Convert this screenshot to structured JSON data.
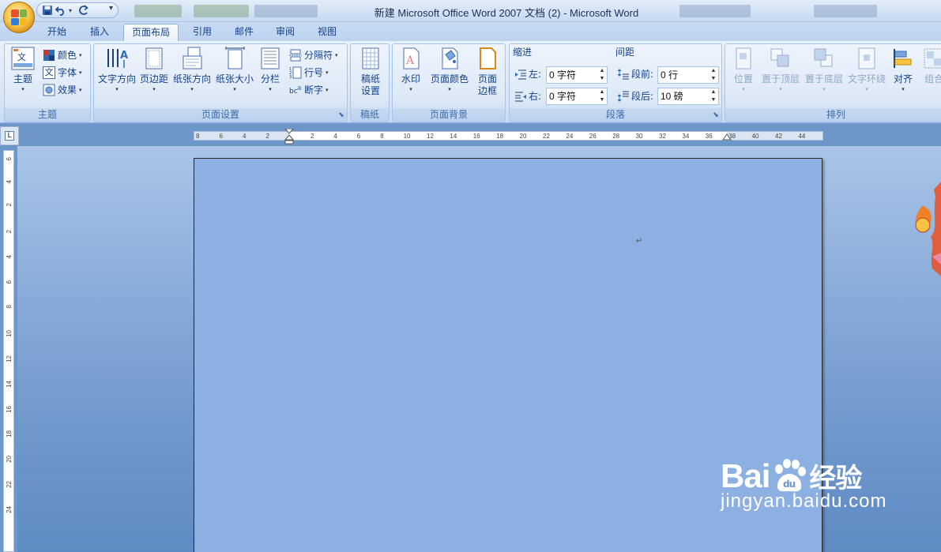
{
  "window": {
    "title": "新建 Microsoft Office Word 2007 文档 (2) - Microsoft Word"
  },
  "quick_access": {
    "save_icon": "save-icon",
    "undo_icon": "undo-icon",
    "redo_icon": "redo-icon",
    "customize_icon": "chevron-down-icon"
  },
  "tabs": [
    {
      "label": "开始"
    },
    {
      "label": "插入"
    },
    {
      "label": "页面布局"
    },
    {
      "label": "引用"
    },
    {
      "label": "邮件"
    },
    {
      "label": "审阅"
    },
    {
      "label": "视图"
    }
  ],
  "active_tab": "页面布局",
  "ribbon": {
    "themes": {
      "group_label": "主题",
      "themes_btn": "主题",
      "colors_btn": "颜色",
      "fonts_btn": "字体",
      "effects_btn": "效果",
      "fonts_icon_glyph": "文"
    },
    "page_setup": {
      "group_label": "页面设置",
      "text_direction": "文字方向",
      "margins": "页边距",
      "orientation": "纸张方向",
      "size": "纸张大小",
      "columns": "分栏",
      "breaks": "分隔符",
      "line_numbers": "行号",
      "hyphenation": "断字"
    },
    "manuscript": {
      "group_label": "稿纸",
      "settings_line1": "稿纸",
      "settings_line2": "设置"
    },
    "page_background": {
      "group_label": "页面背景",
      "watermark": "水印",
      "page_color": "页面颜色",
      "borders_line1": "页面",
      "borders_line2": "边框"
    },
    "paragraph": {
      "group_label": "段落",
      "indent_title": "缩进",
      "spacing_title": "间距",
      "left_label": "左:",
      "left_value": "0 字符",
      "right_label": "右:",
      "right_value": "0 字符",
      "before_label": "段前:",
      "before_value": "0 行",
      "after_label": "段后:",
      "after_value": "10 磅"
    },
    "arrange": {
      "group_label": "排列",
      "position": "位置",
      "bring_front": "置于顶层",
      "send_back": "置于底层",
      "text_wrap": "文字环绕",
      "align": "对齐",
      "group": "组合"
    }
  },
  "ruler": {
    "corner_glyph": "L",
    "h_ticks": [
      "8",
      "6",
      "4",
      "2",
      "2",
      "4",
      "6",
      "8",
      "10",
      "12",
      "14",
      "16",
      "18",
      "20",
      "22",
      "24",
      "26",
      "28",
      "30",
      "32",
      "34",
      "36",
      "38",
      "40",
      "42",
      "44"
    ],
    "v_ticks": [
      "6",
      "4",
      "2",
      "2",
      "4",
      "6",
      "8",
      "10",
      "12",
      "14",
      "16",
      "18",
      "20",
      "22",
      "24"
    ]
  },
  "document": {
    "paragraph_mark": "↵"
  },
  "watermark": {
    "brand": "Bai",
    "brand2": "du",
    "cn": "经验",
    "url": "jingyan.baidu.com"
  },
  "colors": {
    "accent": "#15428b",
    "page": "#8bb0e1",
    "ribbon": "#dbe7f6"
  }
}
